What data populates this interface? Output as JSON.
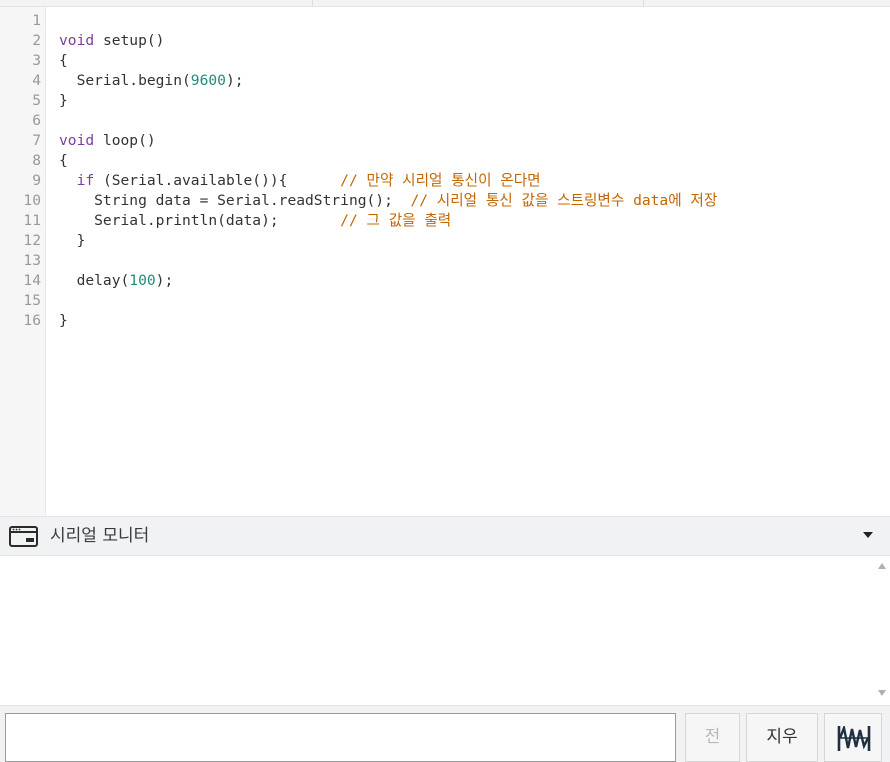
{
  "editor": {
    "lines": [
      {
        "num": "1",
        "tokens": []
      },
      {
        "num": "2",
        "tokens": [
          {
            "t": "void",
            "c": "kw"
          },
          {
            "t": " setup()",
            "c": ""
          }
        ]
      },
      {
        "num": "3",
        "tokens": [
          {
            "t": "{",
            "c": ""
          }
        ]
      },
      {
        "num": "4",
        "tokens": [
          {
            "t": "  Serial.begin(",
            "c": ""
          },
          {
            "t": "9600",
            "c": "num"
          },
          {
            "t": ");",
            "c": ""
          }
        ]
      },
      {
        "num": "5",
        "tokens": [
          {
            "t": "}",
            "c": ""
          }
        ]
      },
      {
        "num": "6",
        "tokens": []
      },
      {
        "num": "7",
        "tokens": [
          {
            "t": "void",
            "c": "kw"
          },
          {
            "t": " loop()",
            "c": ""
          }
        ]
      },
      {
        "num": "8",
        "tokens": [
          {
            "t": "{",
            "c": ""
          }
        ]
      },
      {
        "num": "9",
        "tokens": [
          {
            "t": "  ",
            "c": ""
          },
          {
            "t": "if",
            "c": "kw"
          },
          {
            "t": " (Serial.available()){      ",
            "c": ""
          },
          {
            "t": "// 만약 시리얼 통신이 온다면",
            "c": "cm"
          }
        ]
      },
      {
        "num": "10",
        "tokens": [
          {
            "t": "    String data = Serial.readString();  ",
            "c": ""
          },
          {
            "t": "// 시리얼 통신 값을 스트링변수 data에 저장",
            "c": "cm"
          }
        ]
      },
      {
        "num": "11",
        "tokens": [
          {
            "t": "    Serial.println(data);       ",
            "c": ""
          },
          {
            "t": "// 그 값을 출력",
            "c": "cm"
          }
        ]
      },
      {
        "num": "12",
        "tokens": [
          {
            "t": "  }",
            "c": ""
          }
        ]
      },
      {
        "num": "13",
        "tokens": []
      },
      {
        "num": "14",
        "tokens": [
          {
            "t": "  delay(",
            "c": ""
          },
          {
            "t": "100",
            "c": "num"
          },
          {
            "t": ");",
            "c": ""
          }
        ]
      },
      {
        "num": "15",
        "tokens": []
      },
      {
        "num": "16",
        "tokens": [
          {
            "t": "}",
            "c": ""
          }
        ]
      }
    ]
  },
  "serial_monitor": {
    "title": "시리얼 모니터",
    "input_value": "",
    "send_label": "전",
    "clear_label": "지우",
    "icons": {
      "monitor": "serial-monitor-window-icon",
      "collapse": "caret-down-icon",
      "graph": "waveform-graph-icon"
    }
  },
  "colors": {
    "keyword": "#7a3e9d",
    "number": "#228b7a",
    "comment": "#c46600",
    "text": "#333333",
    "line_number": "#999999"
  }
}
